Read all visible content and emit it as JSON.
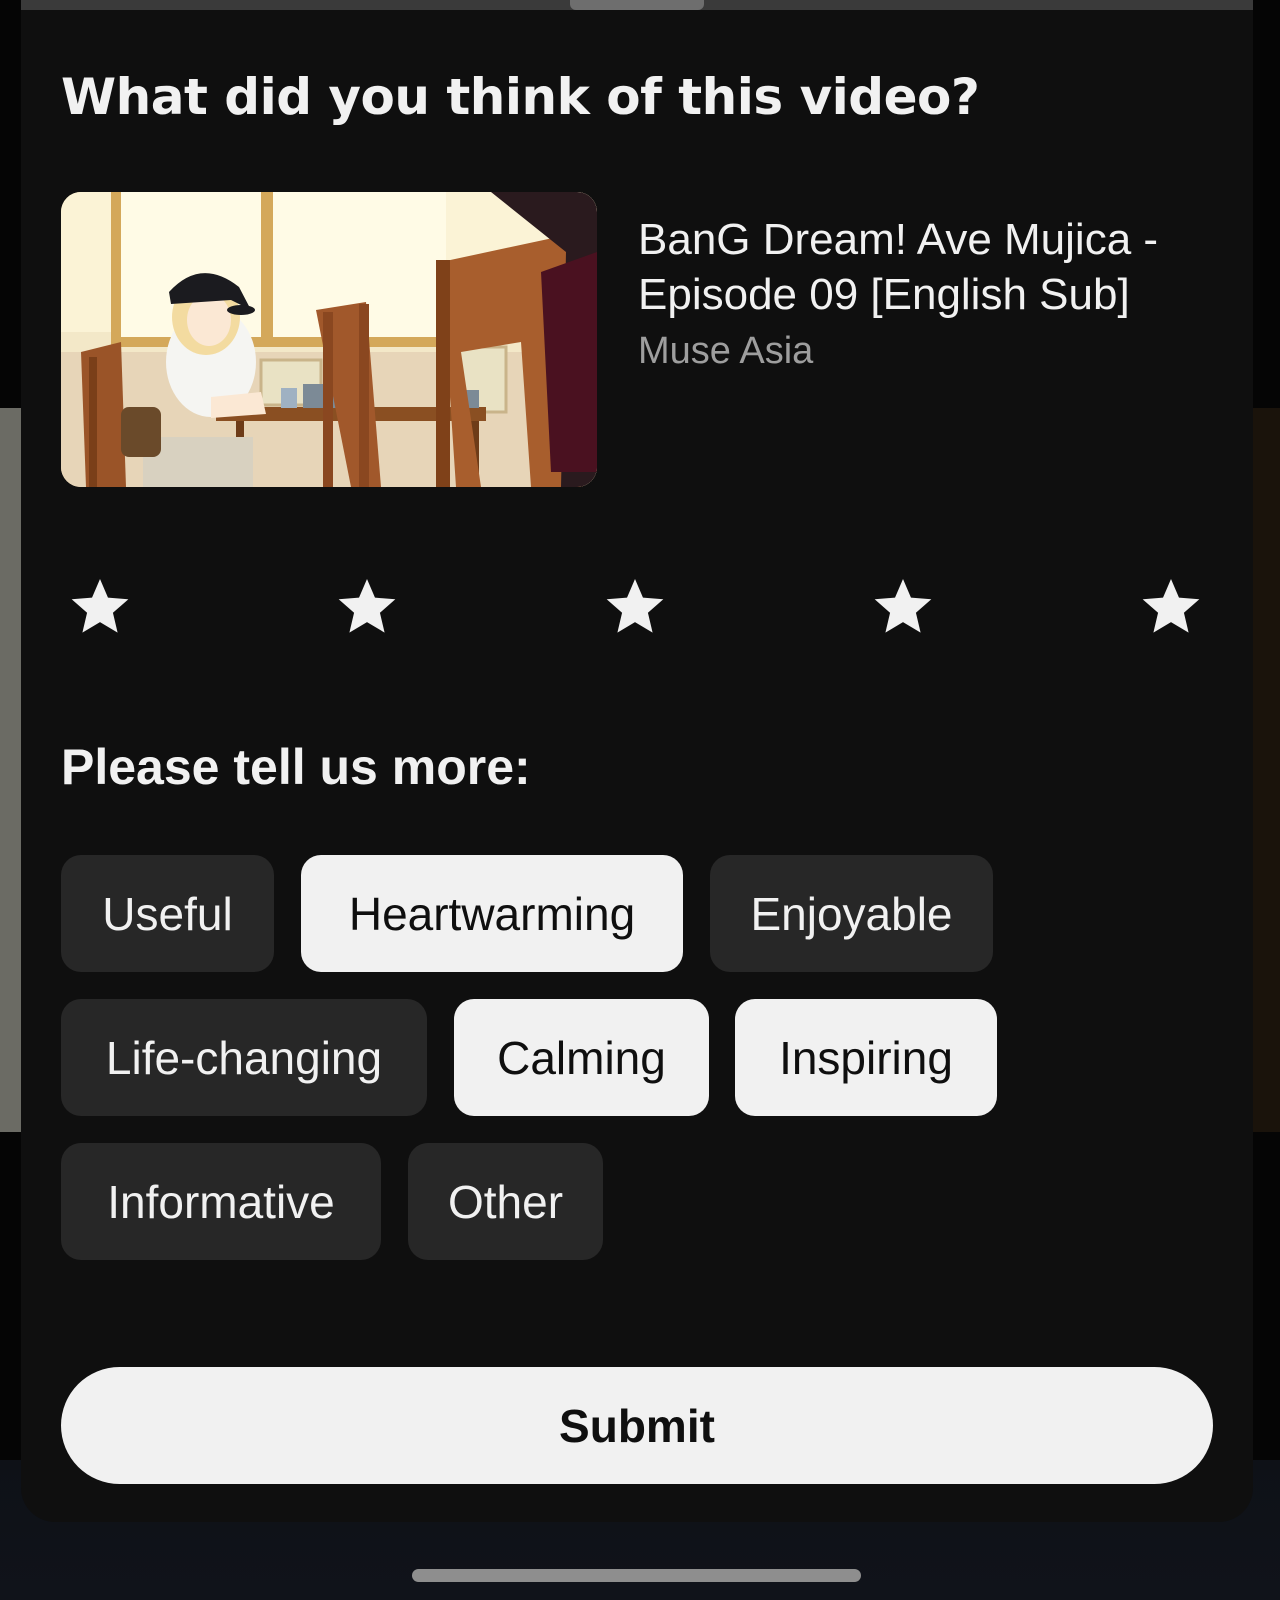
{
  "dialog": {
    "title": "What did you think of this video?"
  },
  "video": {
    "title": "BanG Dream! Ave Mujica - Episode 09 [English Sub]",
    "channel": "Muse Asia",
    "thumbnail_icon": "anime-scene-thumbnail"
  },
  "rating": {
    "max_stars": 5,
    "selected": 0,
    "star_icon": "star-icon",
    "star_color": "#f1f1f1"
  },
  "feedback": {
    "prompt": "Please tell us more:",
    "chips": [
      {
        "label": "Useful",
        "selected": false
      },
      {
        "label": "Heartwarming",
        "selected": true
      },
      {
        "label": "Enjoyable",
        "selected": false
      },
      {
        "label": "Life-changing",
        "selected": false
      },
      {
        "label": "Calming",
        "selected": true
      },
      {
        "label": "Inspiring",
        "selected": true
      },
      {
        "label": "Informative",
        "selected": false
      },
      {
        "label": "Other",
        "selected": false
      }
    ]
  },
  "actions": {
    "submit_label": "Submit"
  },
  "theme": {
    "sheet_background": "#0f0f0f",
    "chip_background": "#272727",
    "chip_selected_background": "#f1f1f1",
    "text_primary": "#f1f1f1",
    "text_secondary": "#9e9e9e"
  }
}
